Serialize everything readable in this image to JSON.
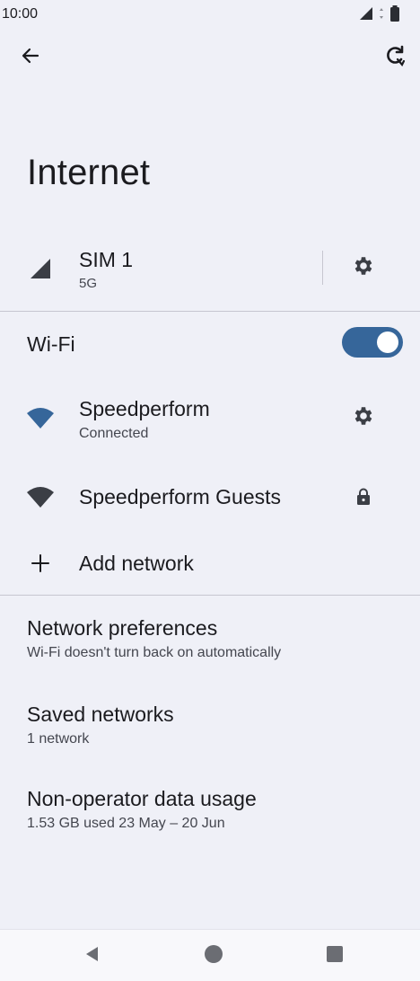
{
  "status_bar": {
    "time": "10:00"
  },
  "app_bar": {
    "title": "Internet"
  },
  "sim": {
    "name": "SIM 1",
    "network": "5G"
  },
  "wifi": {
    "label": "Wi-Fi",
    "enabled": true,
    "networks": [
      {
        "name": "Speedperform",
        "status": "Connected"
      },
      {
        "name": "Speedperform Guests"
      }
    ],
    "add_network_label": "Add network"
  },
  "preferences": [
    {
      "title": "Network preferences",
      "subtitle": "Wi-Fi doesn't turn back on automatically"
    },
    {
      "title": "Saved networks",
      "subtitle": "1 network"
    },
    {
      "title": "Non-operator data usage",
      "subtitle": "1.53 GB used 23 May – 20 Jun"
    }
  ],
  "colors": {
    "accent": "#36669a",
    "background": "#eff0f7",
    "icon": "#3b3e45"
  },
  "icons": {
    "back": "arrow-left-icon",
    "refresh": "refresh-icon",
    "signal": "cell-signal-icon",
    "settings": "gear-icon",
    "wifi": "wifi-icon",
    "lock": "lock-icon",
    "add": "plus-icon"
  }
}
